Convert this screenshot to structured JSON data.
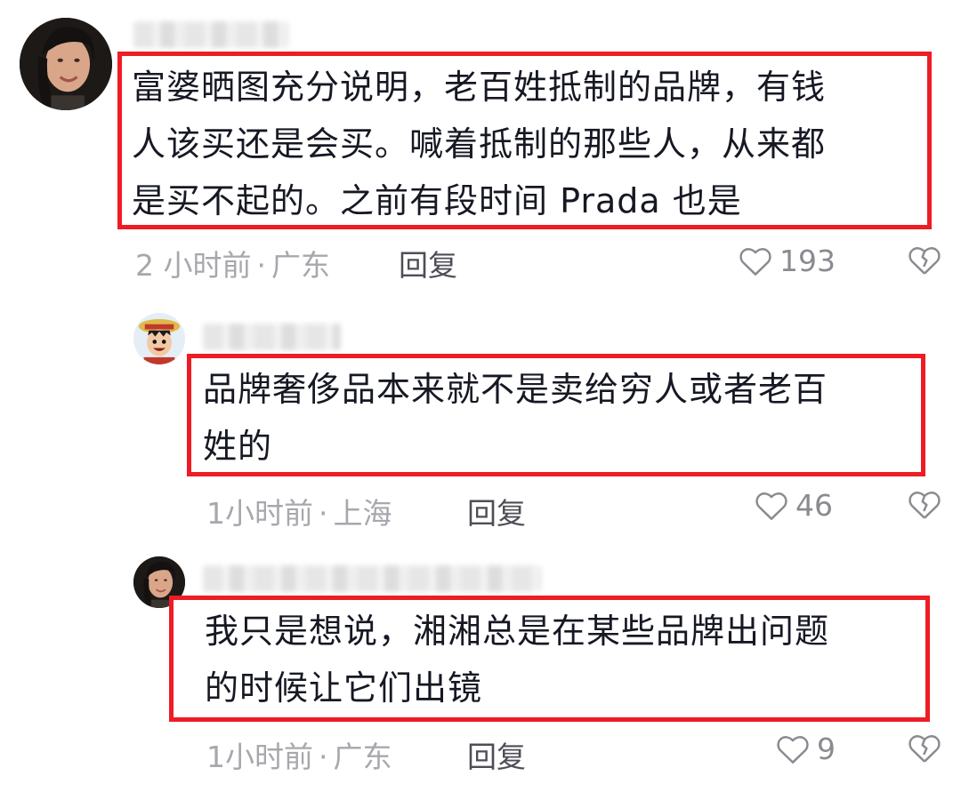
{
  "comments": [
    {
      "text_lines": [
        "富婆晒图充分说明，老百姓抵制的品牌，有钱",
        "人该买还是会买。喊着抵制的那些人，从来都",
        "是买不起的。之前有段时间 Prada 也是"
      ],
      "time": "2 小时前",
      "location": "广东",
      "reply_label": "回复",
      "likes": "193",
      "avatar_icon": "woman-portrait-avatar"
    },
    {
      "text_lines": [
        "品牌奢侈品本来就不是卖给穷人或者老百",
        "姓的"
      ],
      "time": "1小时前",
      "location": "上海",
      "reply_label": "回复",
      "likes": "46",
      "avatar_icon": "cartoon-pirate-avatar"
    },
    {
      "text_lines": [
        "我只是想说，湘湘总是在某些品牌出问题",
        "的时候让它们出镜"
      ],
      "time": "1小时前",
      "location": "广东",
      "reply_label": "回复",
      "likes": "9",
      "avatar_icon": "woman-portrait-avatar"
    }
  ],
  "separator": "·",
  "colors": {
    "highlight": "#ee1c24",
    "meta": "#a7a8ad",
    "text": "#161823"
  }
}
